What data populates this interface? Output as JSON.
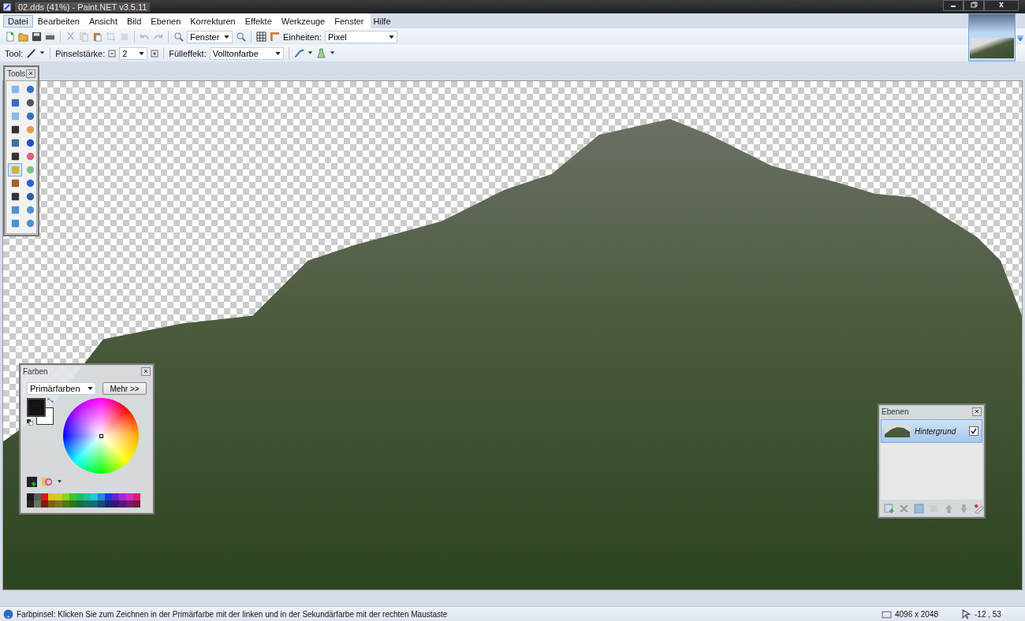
{
  "window": {
    "title": "02.dds (41%) - Paint.NET v3.5.11"
  },
  "menu": [
    {
      "label": "Datei",
      "selected": true
    },
    {
      "label": "Bearbeiten",
      "selected": false
    },
    {
      "label": "Ansicht",
      "selected": false
    },
    {
      "label": "Bild",
      "selected": false
    },
    {
      "label": "Ebenen",
      "selected": false
    },
    {
      "label": "Korrekturen",
      "selected": false
    },
    {
      "label": "Effekte",
      "selected": false
    },
    {
      "label": "Werkzeuge",
      "selected": false
    },
    {
      "label": "Fenster",
      "selected": false
    },
    {
      "label": "Hilfe",
      "selected": false
    }
  ],
  "toolbar": {
    "zoom_value": "Fenster",
    "units_label": "Einheiten:",
    "units_value": "Pixel"
  },
  "tool_bar": {
    "tool_label": "Tool:",
    "brush_label": "Pinselstärke:",
    "brush_value": "2",
    "fill_label": "Fülleffekt:",
    "fill_value": "Volltonfarbe"
  },
  "tools_panel": {
    "title": "Tools",
    "tools": [
      {
        "selected": false
      },
      {
        "selected": false
      },
      {
        "selected": false
      },
      {
        "selected": false
      },
      {
        "selected": false
      },
      {
        "selected": false
      },
      {
        "selected": false
      },
      {
        "selected": false
      },
      {
        "selected": false
      },
      {
        "selected": false
      },
      {
        "selected": false
      },
      {
        "selected": false
      },
      {
        "selected": true
      },
      {
        "selected": false
      },
      {
        "selected": false
      },
      {
        "selected": false
      },
      {
        "selected": false
      },
      {
        "selected": false
      },
      {
        "selected": false
      },
      {
        "selected": false
      },
      {
        "selected": false
      },
      {
        "selected": false
      }
    ]
  },
  "colors_panel": {
    "title": "Farben",
    "mode": "Primärfarben",
    "more_button": "Mehr >>",
    "swatches": [
      {
        "kind": "primary",
        "color": "#141414"
      },
      {
        "kind": "secondary",
        "color": "#ffffff"
      }
    ],
    "palette": [
      {
        "color": "#1a1a1a"
      },
      {
        "color": "#5c5c5c"
      },
      {
        "color": "#d81818"
      },
      {
        "color": "#e0c020"
      },
      {
        "color": "#c8d020"
      },
      {
        "color": "#90d028"
      },
      {
        "color": "#38c828"
      },
      {
        "color": "#20c060"
      },
      {
        "color": "#20c0a8"
      },
      {
        "color": "#20c8d8"
      },
      {
        "color": "#2088d8"
      },
      {
        "color": "#2038d0"
      },
      {
        "color": "#6028d0"
      },
      {
        "color": "#a828d0"
      },
      {
        "color": "#d828c0"
      },
      {
        "color": "#d82070"
      },
      {
        "color": "#202820"
      },
      {
        "color": "#707060"
      },
      {
        "color": "#801818"
      },
      {
        "color": "#806018"
      },
      {
        "color": "#787818"
      },
      {
        "color": "#507818"
      },
      {
        "color": "#287818"
      },
      {
        "color": "#187040"
      },
      {
        "color": "#187060"
      },
      {
        "color": "#186878"
      },
      {
        "color": "#184878"
      },
      {
        "color": "#182878"
      },
      {
        "color": "#381878"
      },
      {
        "color": "#581878"
      },
      {
        "color": "#781870"
      },
      {
        "color": "#781840"
      }
    ]
  },
  "layers_panel": {
    "title": "Ebenen",
    "layers": [
      {
        "name": "Hintergrund",
        "visible": true,
        "selected": true
      }
    ]
  },
  "status_bar": {
    "hint": "Farbpinsel: Klicken Sie zum Zeichnen in der Primärfarbe mit der linken und in der Sekundärfarbe mit der rechten Maustaste",
    "image_size": "4096 x 2048",
    "cursor_position": "-12 , 53"
  }
}
